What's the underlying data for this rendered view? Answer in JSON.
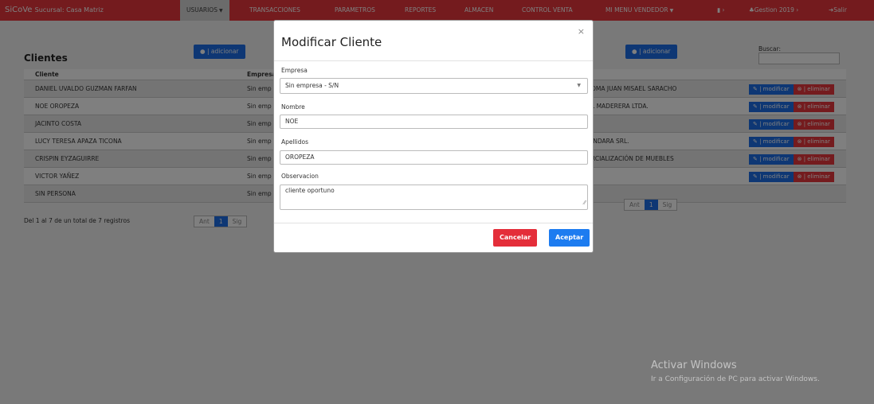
{
  "navbar": {
    "brand": "SiCoVe",
    "brand_sub": "Sucursal: Casa Matriz",
    "items": [
      {
        "label": "USUARIOS"
      },
      {
        "label": "TRANSACCIONES"
      },
      {
        "label": "PARAMETROS"
      },
      {
        "label": "REPORTES"
      },
      {
        "label": "ALMACEN"
      },
      {
        "label": "CONTROL VENTA"
      },
      {
        "label": "MI MENU VENDEDOR"
      }
    ],
    "gestion": "Gestion 2019",
    "salir": "Salir"
  },
  "page": {
    "title": "Clientes",
    "add_label": "| adicionar",
    "search_label": "Buscar:",
    "headers": [
      "Cliente",
      "Empresa"
    ],
    "rows": [
      {
        "cliente": "DANIEL UVALDO GUZMAN FARFAN",
        "empresa": "Sin emp",
        "empresa_right": "OMA JUAN MISAEL SARACHO"
      },
      {
        "cliente": "NOE OROPEZA",
        "empresa": "Sin emp",
        "empresa_right": "L MADERERA LTDA."
      },
      {
        "cliente": "JACINTO COSTA",
        "empresa": "Sin emp",
        "empresa_right": ""
      },
      {
        "cliente": "LUCY TERESA APAZA TICONA",
        "empresa": "Sin emp",
        "empresa_right": "INDARA SRL."
      },
      {
        "cliente": "CRISPIN EYZAGUIRRE",
        "empresa": "Sin emp",
        "empresa_right": "RCIALIZACIÓN DE MUEBLES"
      },
      {
        "cliente": "VICTOR YAÑEZ",
        "empresa": "Sin emp",
        "empresa_right": ""
      },
      {
        "cliente": "SIN PERSONA",
        "empresa": "Sin emp",
        "empresa_right": ""
      }
    ],
    "modify_label": "| modificar",
    "delete_label": "| eliminar",
    "info": "Del 1 al 7 de un total de 7 registros",
    "pager": {
      "prev": "Ant",
      "current": "1",
      "next": "Sig"
    }
  },
  "modal": {
    "title": "Modificar Cliente",
    "close": "×",
    "empresa_label": "Empresa",
    "empresa_value": "Sin empresa - S/N",
    "nombre_label": "Nombre",
    "nombre_value": "NOE",
    "apellidos_label": "Apellidos",
    "apellidos_value": "OROPEZA",
    "observacion_label": "Observacion",
    "observacion_value": "cliente oportuno",
    "cancel": "Cancelar",
    "accept": "Aceptar"
  },
  "watermark": {
    "line1": "Activar Windows",
    "line2": "Ir a Configuración de PC para activar Windows."
  },
  "colors": {
    "navbar": "#e8373c",
    "primary": "#1d6fe8",
    "danger": "#e42e3a"
  }
}
